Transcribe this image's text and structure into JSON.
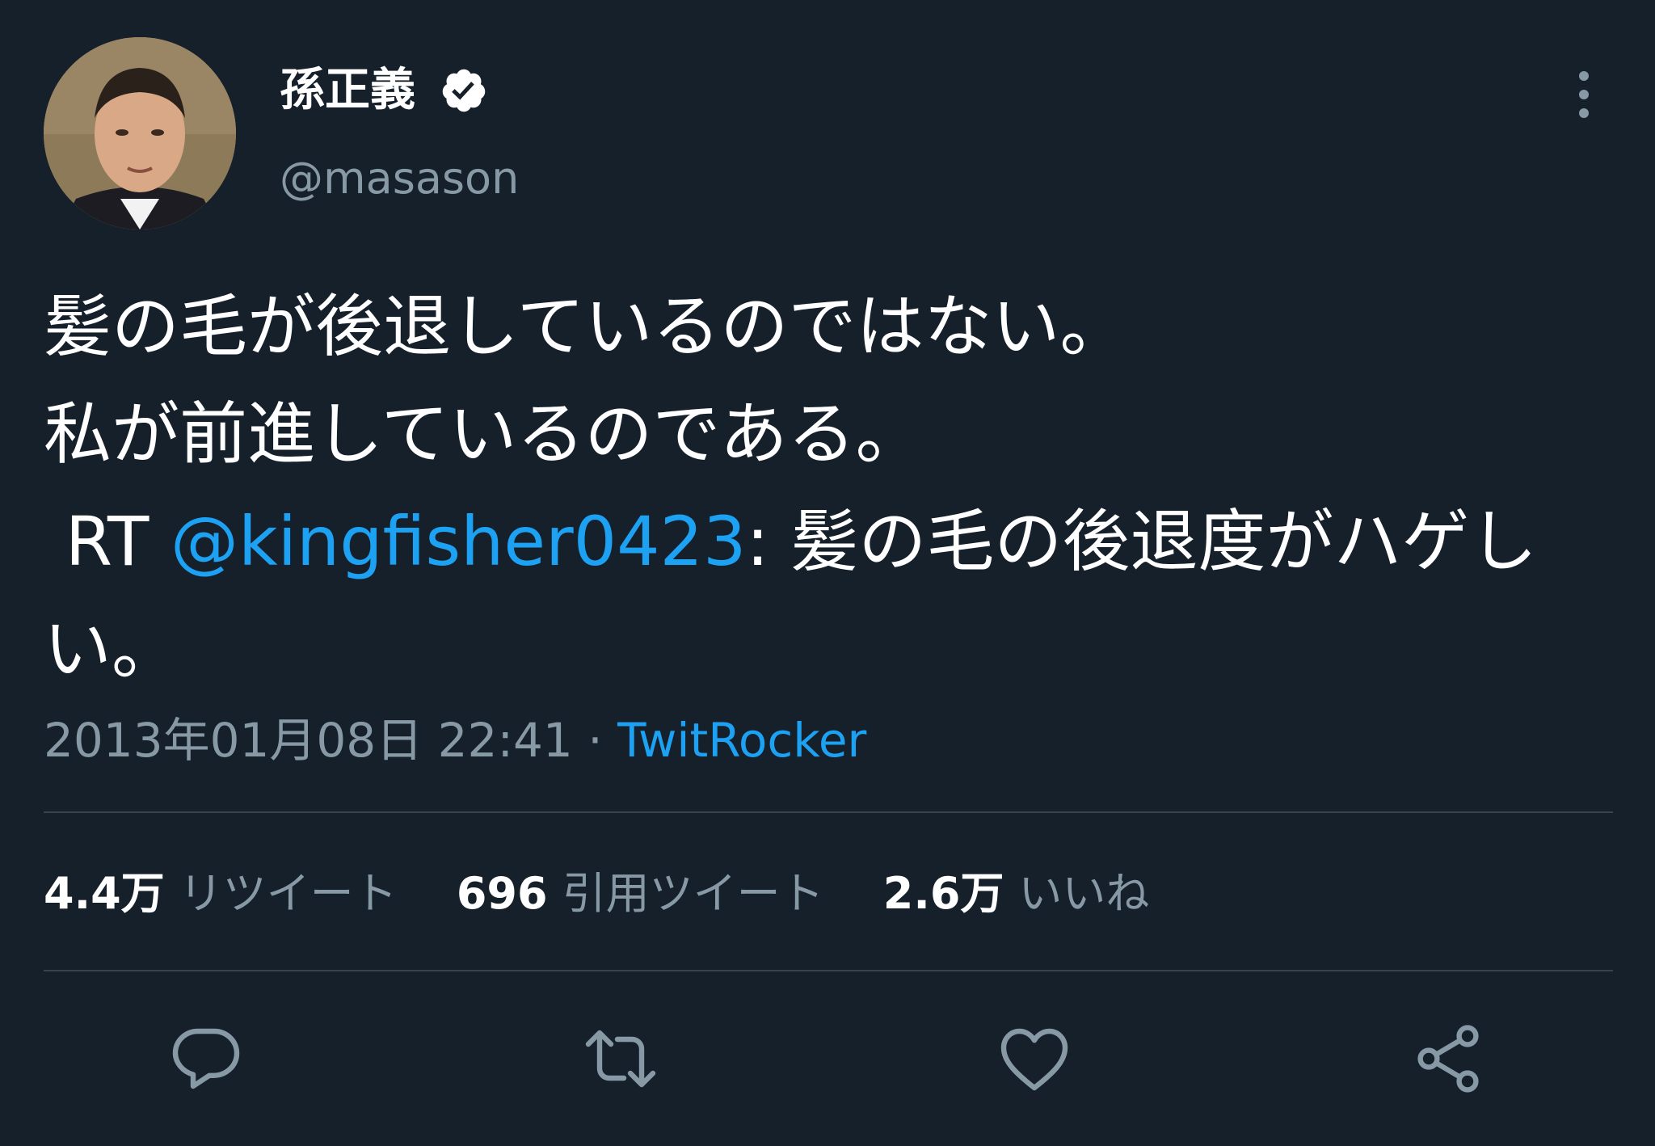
{
  "author": {
    "display_name": "孫正義",
    "handle": "@masason",
    "verified": true
  },
  "tweet": {
    "line1": "髪の毛が後退しているのではない。",
    "line2": "私が前進しているのである。",
    "rt_prefix": " RT ",
    "mention": "@kingfisher0423",
    "rt_text": ": 髪の毛の後退度がハゲしい。"
  },
  "meta": {
    "timestamp": "2013年01月08日 22:41",
    "separator": " · ",
    "source": "TwitRocker"
  },
  "stats": {
    "retweets": {
      "count": "4.4万",
      "label": "リツイート"
    },
    "quotes": {
      "count": "696",
      "label": "引用ツイート"
    },
    "likes": {
      "count": "2.6万",
      "label": "いいね"
    }
  },
  "actions": [
    "reply-icon",
    "retweet-icon",
    "like-icon",
    "share-icon"
  ],
  "colors": {
    "background": "#15202b",
    "accent": "#1da1f2",
    "secondary_text": "#8899a6",
    "divider": "#38444d"
  }
}
